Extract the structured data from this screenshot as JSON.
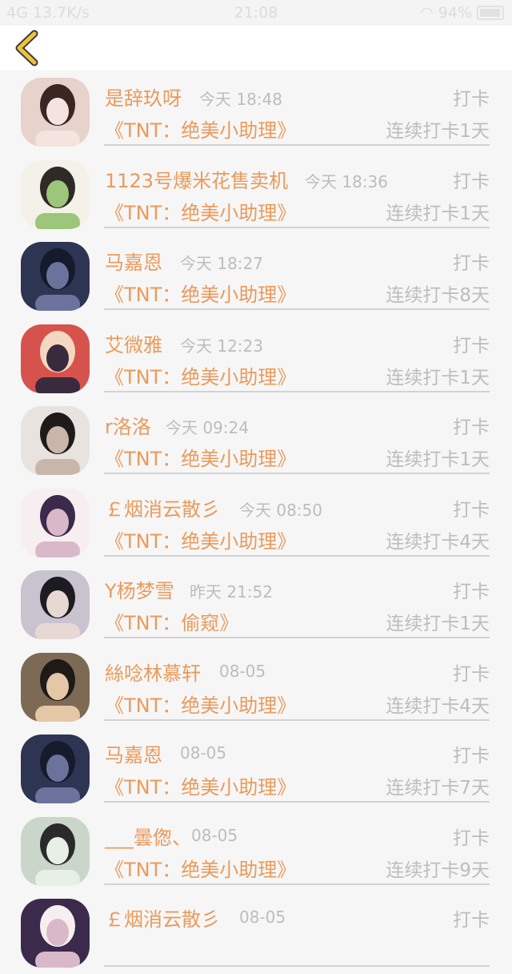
{
  "status_bar": {
    "left": "4G 13.7K/s",
    "time": "21:08",
    "battery": "94%"
  },
  "nav": {
    "back_icon": "chevron-left-icon"
  },
  "colors": {
    "accent": "#ea9a5c",
    "back_icon": "#efc23d",
    "muted": "#bdbdbd"
  },
  "rows": [
    {
      "name": "是辞玖呀",
      "time": "今天 18:48",
      "action": "打卡",
      "book": "《TNT：绝美小助理》",
      "streak": "连续打卡1天"
    },
    {
      "name": "1123号爆米花售卖机",
      "time": "今天 18:36",
      "action": "打卡",
      "book": "《TNT：绝美小助理》",
      "streak": "连续打卡1天"
    },
    {
      "name": "马嘉恩",
      "time": "今天 18:27",
      "action": "打卡",
      "book": "《TNT：绝美小助理》",
      "streak": "连续打卡8天"
    },
    {
      "name": "艾微雅",
      "time": "今天 12:23",
      "action": "打卡",
      "book": "《TNT：绝美小助理》",
      "streak": "连续打卡1天"
    },
    {
      "name": "r洛洛",
      "time": "今天 09:24",
      "action": "打卡",
      "book": "《TNT：绝美小助理》",
      "streak": "连续打卡1天"
    },
    {
      "name": "￡烟消云散彡",
      "time": "今天 08:50",
      "action": "打卡",
      "book": "《TNT：绝美小助理》",
      "streak": "连续打卡4天"
    },
    {
      "name": "Y杨梦雪",
      "time": "昨天 21:52",
      "action": "打卡",
      "book": "《TNT：偷窥》",
      "streak": "连续打卡1天"
    },
    {
      "name": "絲唸林慕轩",
      "time": "08-05",
      "action": "打卡",
      "book": "《TNT：绝美小助理》",
      "streak": "连续打卡4天"
    },
    {
      "name": "马嘉恩",
      "time": "08-05",
      "action": "打卡",
      "book": "《TNT：绝美小助理》",
      "streak": "连续打卡7天"
    },
    {
      "name": "___曇偬、",
      "time": "08-05",
      "action": "打卡",
      "book": "《TNT：绝美小助理》",
      "streak": "连续打卡9天"
    },
    {
      "name": "￡烟消云散彡",
      "time": "08-05",
      "action": "打卡",
      "book": "",
      "streak": ""
    }
  ]
}
